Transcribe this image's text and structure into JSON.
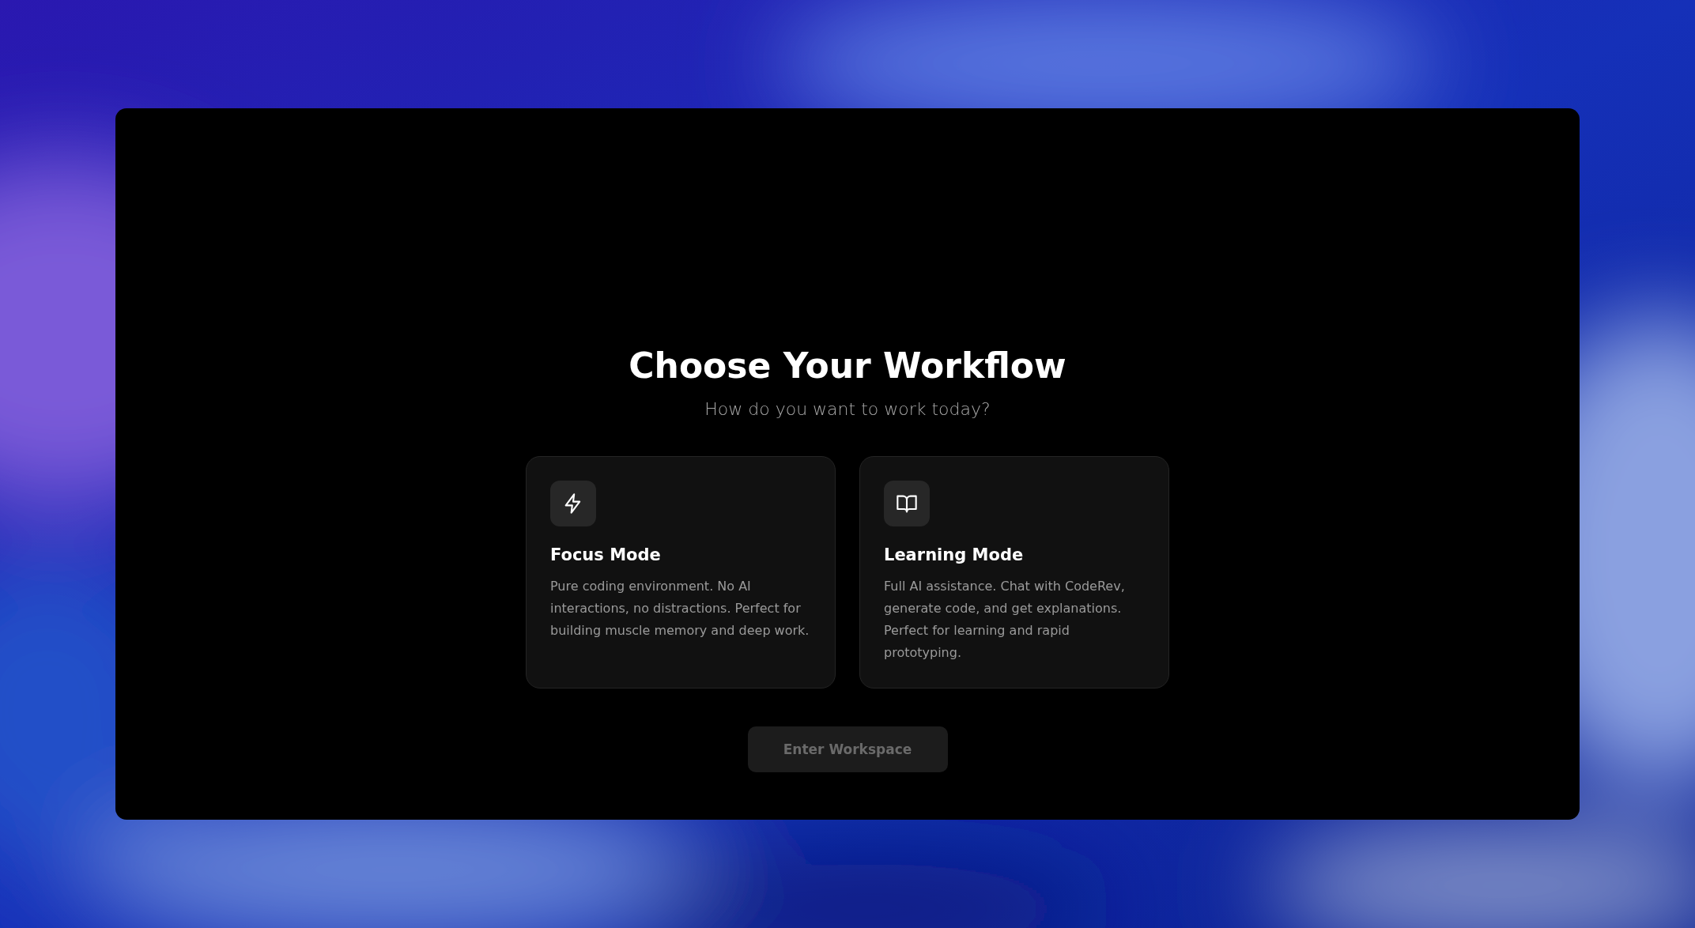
{
  "title": "Choose Your Workflow",
  "subtitle": "How do you want to work today?",
  "modes": [
    {
      "kind": "focus",
      "title": "Focus Mode",
      "description": "Pure coding environment. No AI interactions, no distractions. Perfect for building muscle memory and deep work.",
      "selected": false
    },
    {
      "kind": "learning",
      "title": "Learning Mode",
      "description": "Full AI assistance. Chat with CodeRev, generate code, and get explanations. Perfect for learning and rapid prototyping.",
      "selected": false
    }
  ],
  "button": {
    "label": "Enter Workspace",
    "disabled": true
  }
}
